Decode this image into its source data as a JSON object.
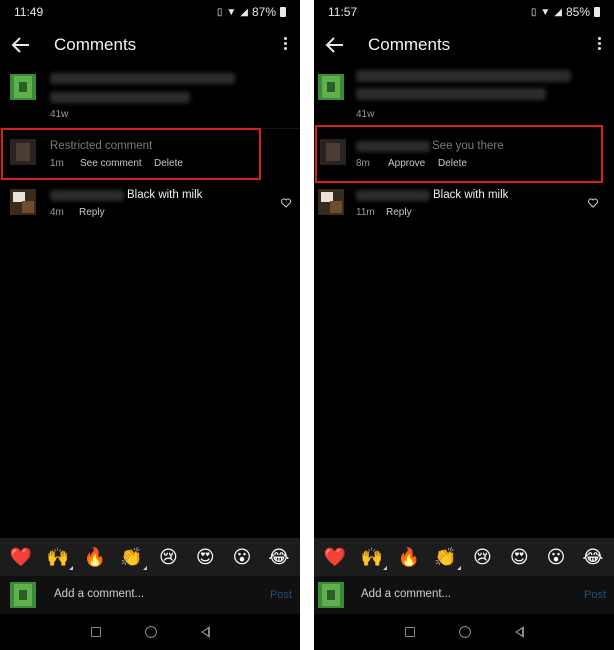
{
  "left": {
    "status": {
      "time": "11:49",
      "battery": "87%"
    },
    "header": {
      "title": "Comments"
    },
    "comments": [
      {
        "age": "41w"
      },
      {
        "text": "Restricted comment",
        "age": "1m",
        "action1": "See comment",
        "action2": "Delete"
      },
      {
        "text": "Black with milk",
        "age": "4m",
        "action1": "Reply"
      }
    ],
    "compose": {
      "placeholder": "Add a comment...",
      "post": "Post"
    }
  },
  "right": {
    "status": {
      "time": "11:57",
      "battery": "85%"
    },
    "header": {
      "title": "Comments"
    },
    "comments": [
      {
        "age": "41w"
      },
      {
        "text": "See you there",
        "age": "8m",
        "action1": "Approve",
        "action2": "Delete"
      },
      {
        "text": "Black with milk",
        "age": "11m",
        "action1": "Reply"
      }
    ],
    "compose": {
      "placeholder": "Add a comment...",
      "post": "Post"
    }
  },
  "emojis": [
    "❤️",
    "🙌",
    "🔥",
    "👏",
    "😢",
    "😍",
    "😮",
    "😂"
  ],
  "colors": {
    "highlight": "#d61f1f",
    "background": "#000000",
    "emoji_bar": "#1c1c1c"
  }
}
